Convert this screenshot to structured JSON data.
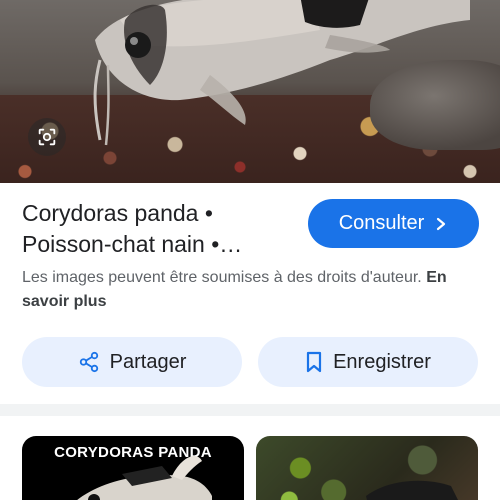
{
  "result": {
    "title": "Corydoras panda • Poisson-chat nain •…",
    "consult_label": "Consulter",
    "notice_text": "Les images peuvent être soumises à des droits d'auteur.",
    "learn_more": "En savoir plus"
  },
  "actions": {
    "share_label": "Partager",
    "save_label": "Enregistrer"
  },
  "related": {
    "thumb1_label": "CORYDORAS PANDA"
  },
  "icons": {
    "lens": "lens-icon",
    "chevron": "chevron-right-icon",
    "share": "share-icon",
    "bookmark": "bookmark-icon"
  },
  "colors": {
    "primary": "#1a73e8",
    "tonal_button": "#e8f0fe",
    "text": "#202124",
    "secondary_text": "#5f6368"
  }
}
